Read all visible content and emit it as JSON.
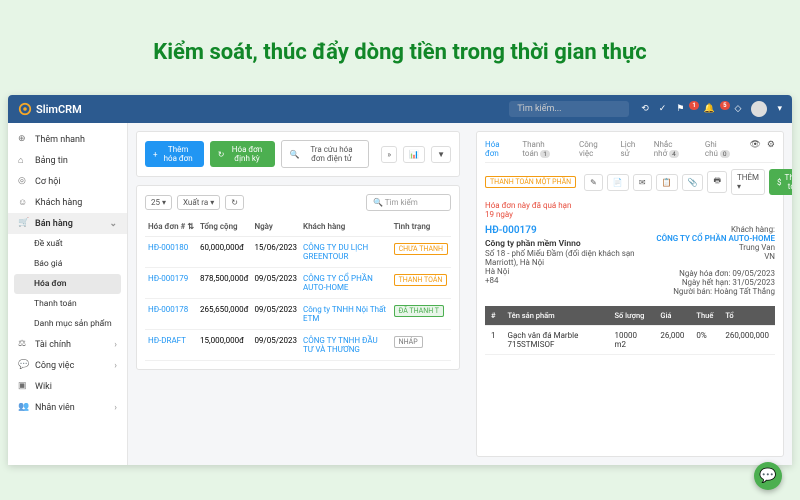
{
  "banner": "Kiểm soát, thúc đẩy dòng tiền trong thời gian thực",
  "brand": "SlimCRM",
  "search_placeholder": "Tìm kiếm...",
  "notif_counts": {
    "share": "",
    "check": "",
    "flag": "1",
    "bell": "5",
    "alert": ""
  },
  "sidebar": {
    "quick_add": "Thêm nhanh",
    "items": [
      {
        "icon": "home",
        "label": "Bảng tin"
      },
      {
        "icon": "target",
        "label": "Cơ hội"
      },
      {
        "icon": "user",
        "label": "Khách hàng"
      },
      {
        "icon": "cart",
        "label": "Bán hàng",
        "expanded": true,
        "children": [
          {
            "label": "Đề xuất"
          },
          {
            "label": "Báo giá"
          },
          {
            "label": "Hóa đơn",
            "active": true
          },
          {
            "label": "Thanh toán"
          },
          {
            "label": "Danh mục sản phẩm"
          }
        ]
      },
      {
        "icon": "scale",
        "label": "Tài chính",
        "chev": true
      },
      {
        "icon": "chat",
        "label": "Công việc",
        "chev": true
      },
      {
        "icon": "wiki",
        "label": "Wiki"
      },
      {
        "icon": "people",
        "label": "Nhân viên",
        "chev": true
      }
    ]
  },
  "toolbar": {
    "add": "Thêm hóa đơn",
    "recurring": "Hóa đơn định kỳ",
    "lookup": "Tra cứu hóa đơn điện tử"
  },
  "list": {
    "page_size": "25",
    "export": "Xuất ra",
    "search_placeholder": "Tìm kiếm",
    "cols": {
      "id": "Hóa đơn #",
      "total": "Tổng cộng",
      "date": "Ngày",
      "cust": "Khách hàng",
      "status": "Tình trạng"
    },
    "rows": [
      {
        "id": "HĐ-000180",
        "total": "60,000,000đ",
        "date": "15/06/2023",
        "cust": "CÔNG TY DU LỊCH GREENTOUR",
        "status": "CHƯA THANH",
        "cls": "st-unpaid"
      },
      {
        "id": "HĐ-000179",
        "total": "878,500,000đ",
        "date": "09/05/2023",
        "cust": "CÔNG TY CỔ PHẦN AUTO-HOME",
        "status": "THANH TOÁN",
        "cls": "st-partial"
      },
      {
        "id": "HĐ-000178",
        "total": "265,650,000đ",
        "date": "09/05/2023",
        "cust": "Công ty TNHH Nội Thất ETM",
        "status": "ĐÃ THANH T",
        "cls": "st-paid"
      },
      {
        "id": "HĐ-DRAFT",
        "total": "15,000,000đ",
        "date": "09/05/2023",
        "cust": "CÔNG TY TNHH ĐẦU TƯ VÀ THƯƠNG",
        "status": "NHÁP",
        "cls": "st-draft"
      }
    ]
  },
  "detail": {
    "tabs": [
      {
        "label": "Hóa đơn",
        "active": true
      },
      {
        "label": "Thanh toán",
        "count": "1"
      },
      {
        "label": "Công việc"
      },
      {
        "label": "Lịch sử"
      },
      {
        "label": "Nhắc nhở",
        "count": "4"
      },
      {
        "label": "Ghi chú",
        "count": "0"
      }
    ],
    "status_badge": "THANH TOÁN MỘT PHẦN",
    "more_label": "THÊM",
    "pay_btn": "Thanh toán",
    "overdue_msg": "Hóa đơn này đã quá hạn",
    "overdue_days": "19 ngày",
    "invoice_no": "HĐ-000179",
    "company": "Công ty phần mềm Vinno",
    "address": "Số 18 - phố Miếu Đầm (đối diện khách sạn Marriott), Hà Nội",
    "city": "Hà Nội",
    "phone": "+84",
    "cust_label": "Khách hàng:",
    "cust_name": "CÔNG TY CỔ PHẦN AUTO-HOME",
    "cust_loc": "Trung Van",
    "cust_country": "VN",
    "dates": {
      "inv_label": "Ngày hóa đơn:",
      "inv_val": "09/05/2023",
      "due_label": "Ngày hết hạn:",
      "due_val": "31/05/2023",
      "seller_label": "Người bán:",
      "seller_val": "Hoàng Tất Thắng"
    },
    "products": {
      "cols": {
        "idx": "#",
        "name": "Tên sản phẩm",
        "qty": "Số lượng",
        "price": "Giá",
        "tax": "Thuế",
        "total": "Tổ"
      },
      "rows": [
        {
          "idx": "1",
          "name": "Gạch vân đá Marble 715STMISOF",
          "qty": "10000 m2",
          "price": "26,000",
          "tax": "0%",
          "total": "260,000,000"
        }
      ]
    }
  }
}
